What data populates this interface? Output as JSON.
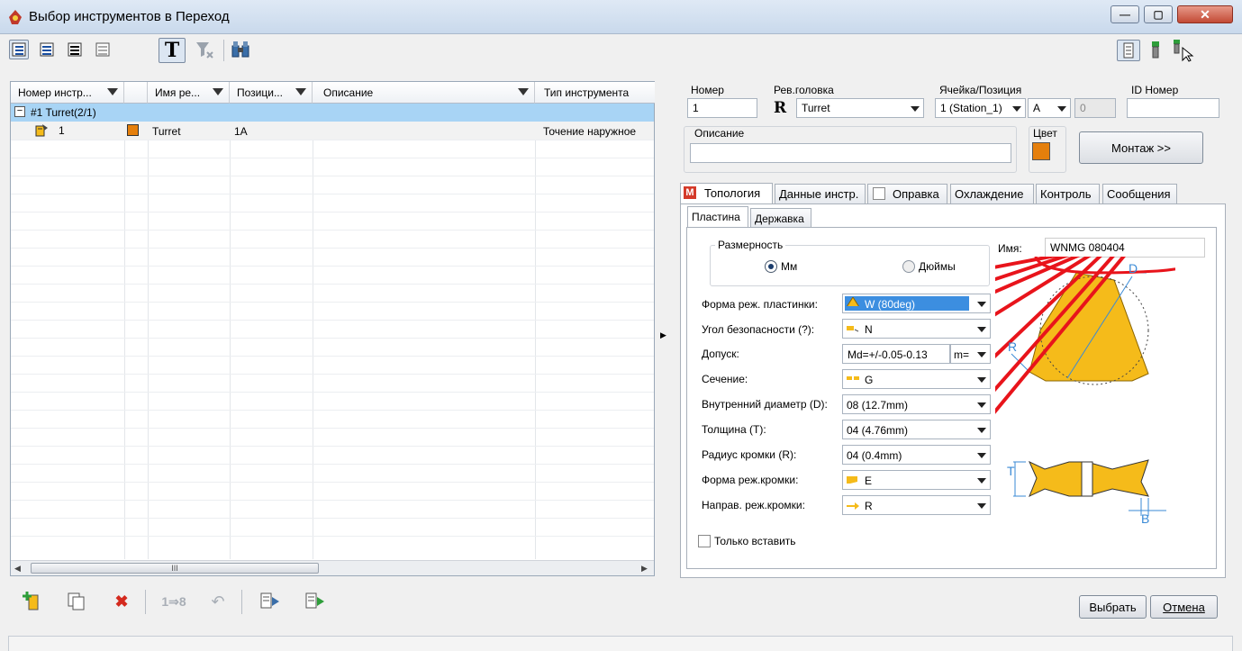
{
  "window": {
    "title": "Выбор инструментов в Переход"
  },
  "grid": {
    "columns": [
      "Номер инстр...",
      "",
      "Имя ре...",
      "Позици...",
      "Описание",
      "Тип инструмента"
    ],
    "group_row": "#1 Turret(2/1)",
    "rows": [
      {
        "number": "1",
        "name": "Turret",
        "position": "1A",
        "description": "",
        "type": "Точение наружное"
      }
    ],
    "scrollbar_grip": "III"
  },
  "colors": {
    "accent": "#e57f0c",
    "selected_row": "#a8d4f5",
    "insert": "#f5bb1a",
    "annotation": "#e8141b"
  },
  "header": {
    "number_label": "Номер",
    "number_value": "1",
    "revolver_label": "Рев.головка",
    "revolver_icon_letter": "R",
    "revolver_value": "Turret",
    "cell_label": "Ячейка/Позиция",
    "cell_value": "1 (Station_1)",
    "position_value": "A",
    "position_extra": "0",
    "id_label": "ID Номер",
    "id_value": "",
    "description_label": "Описание",
    "description_value": "",
    "color_label": "Цвет",
    "mount_button": "Монтаж >>"
  },
  "tabs": [
    {
      "label": "Топология",
      "icon": "M"
    },
    {
      "label": "Данные инстр."
    },
    {
      "label": "Оправка"
    },
    {
      "label": "Охлаждение"
    },
    {
      "label": "Контроль"
    },
    {
      "label": "Сообщения"
    }
  ],
  "subtabs": [
    "Пластина",
    "Державка"
  ],
  "insert": {
    "dimension_label": "Размерность",
    "radio_mm": "Мм",
    "radio_inch": "Дюймы",
    "selected_unit": "Мм",
    "name_label": "Имя:",
    "name_value": "WNMG 080404",
    "fields": [
      {
        "label": "Форма реж. пластинки:",
        "value": "W (80deg)",
        "icon": "triangle-shape-icon"
      },
      {
        "label": "Угол безопасности (?):",
        "value": "N",
        "icon": "clearance-angle-icon"
      },
      {
        "label": "Допуск:",
        "value": "Md=+/-0.05-0.13",
        "extra": "m="
      },
      {
        "label": "Сечение:",
        "value": "G",
        "icon": "section-icon"
      },
      {
        "label": "Внутренний диаметр (D):",
        "value": "08 (12.7mm)"
      },
      {
        "label": "Толщина (T):",
        "value": "04 (4.76mm)"
      },
      {
        "label": "Радиус кромки (R):",
        "value": "04 (0.4mm)"
      },
      {
        "label": "Форма реж.кромки:",
        "value": "E",
        "icon": "edge-shape-icon"
      },
      {
        "label": "Направ. реж.кромки:",
        "value": "R",
        "icon": "edge-direction-icon"
      }
    ],
    "only_insert_label": "Только вставить",
    "diagram_labels": {
      "d": "D",
      "r": "R",
      "t": "T",
      "b": "B"
    }
  },
  "footer": {
    "select_button": "Выбрать",
    "cancel_button": "Отмена"
  }
}
